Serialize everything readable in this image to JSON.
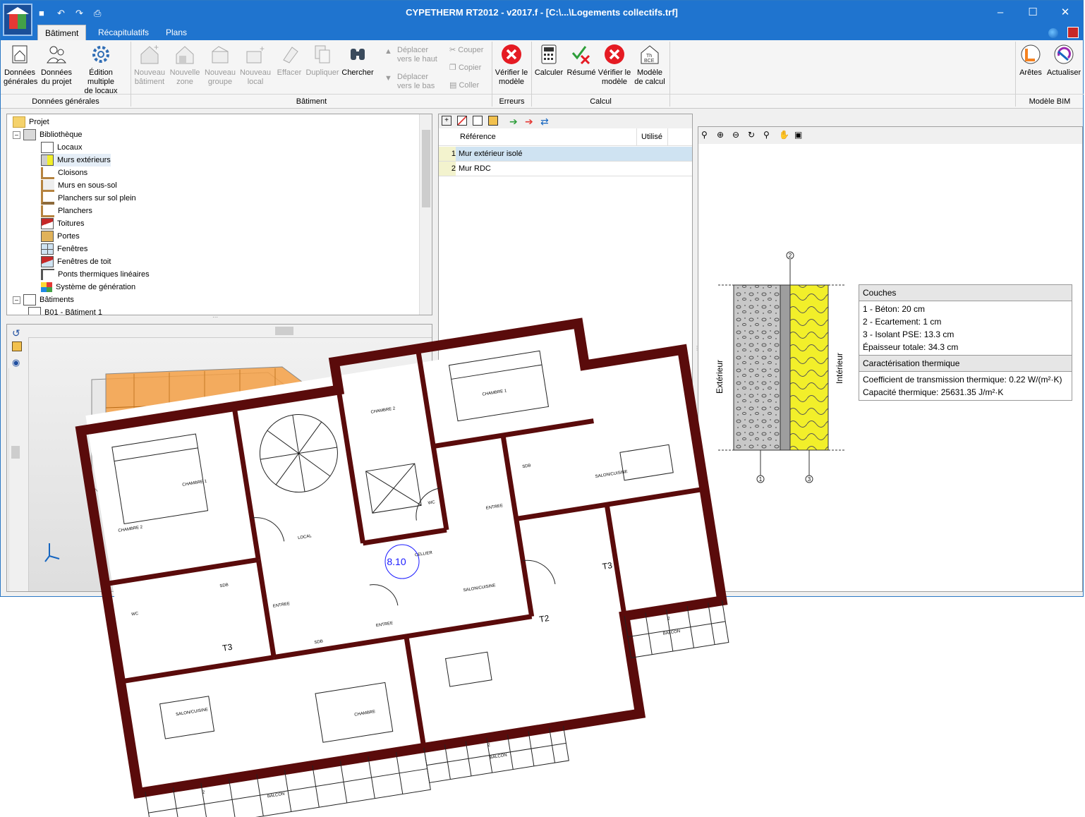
{
  "window": {
    "title": "CYPETHERM RT2012 - v2017.f - [C:\\...\\Logements collectifs.trf]"
  },
  "colors": {
    "titlebar": "#1f74cf",
    "wall": "#5a0b0b",
    "insulation": "#f2ef2a",
    "concrete": "#c8c8c8",
    "selection": "#cfe3f2"
  },
  "tabs": [
    {
      "label": "Bâtiment"
    },
    {
      "label": "Récapitulatifs"
    },
    {
      "label": "Plans"
    }
  ],
  "ribbon": {
    "buttons": [
      {
        "label": "Données générales",
        "l1": "Données",
        "l2": "générales"
      },
      {
        "label": "Données du projet",
        "l1": "Données",
        "l2": "du projet"
      },
      {
        "label": "Édition multiple de locaux",
        "l1": "Édition multiple",
        "l2": "de locaux"
      },
      {
        "label": "Nouveau bâtiment",
        "l1": "Nouveau",
        "l2": "bâtiment"
      },
      {
        "label": "Nouvelle zone",
        "l1": "Nouvelle",
        "l2": "zone"
      },
      {
        "label": "Nouveau groupe",
        "l1": "Nouveau",
        "l2": "groupe"
      },
      {
        "label": "Nouveau local",
        "l1": "Nouveau",
        "l2": "local"
      },
      {
        "label": "Effacer",
        "l1": "Effacer",
        "l2": ""
      },
      {
        "label": "Dupliquer",
        "l1": "Dupliquer",
        "l2": ""
      },
      {
        "label": "Chercher",
        "l1": "Chercher",
        "l2": ""
      },
      {
        "label": "Vérifier le modèle",
        "l1": "Vérifier le",
        "l2": "modèle"
      },
      {
        "label": "Calculer",
        "l1": "Calculer",
        "l2": ""
      },
      {
        "label": "Résumé",
        "l1": "Résumé",
        "l2": ""
      },
      {
        "label": "Vérifier le modèle",
        "l1": "Vérifier le",
        "l2": "modèle"
      },
      {
        "label": "Modèle de calcul",
        "l1": "Modèle",
        "l2": "de calcul"
      },
      {
        "label": "Arêtes",
        "l1": "Arêtes",
        "l2": ""
      },
      {
        "label": "Actualiser",
        "l1": "Actualiser",
        "l2": ""
      }
    ],
    "move_up": {
      "l1": "Déplacer",
      "l2": "vers le haut"
    },
    "move_down": {
      "l1": "Déplacer",
      "l2": "vers le bas"
    },
    "cut": "Couper",
    "copy": "Copier",
    "paste": "Coller",
    "groups": [
      "Données générales",
      "Bâtiment",
      "Erreurs",
      "Calcul",
      "Modèle BIM"
    ]
  },
  "tree": {
    "items": [
      {
        "label": "Projet"
      },
      {
        "label": "Bibliothèque"
      },
      {
        "label": "Locaux"
      },
      {
        "label": "Murs extérieurs"
      },
      {
        "label": "Cloisons"
      },
      {
        "label": "Murs en sous-sol"
      },
      {
        "label": "Planchers sur sol plein"
      },
      {
        "label": "Planchers"
      },
      {
        "label": "Toitures"
      },
      {
        "label": "Portes"
      },
      {
        "label": "Fenêtres"
      },
      {
        "label": "Fenêtres de toit"
      },
      {
        "label": "Ponts thermiques linéaires"
      },
      {
        "label": "Système de génération"
      },
      {
        "label": "Bâtiments"
      },
      {
        "label": "B01 - Bâtiment 1"
      }
    ]
  },
  "grid": {
    "headers": [
      "Référence",
      "Utilisé"
    ],
    "rows": [
      {
        "num": "1",
        "ref": "Mur extérieur isolé",
        "used": ""
      },
      {
        "num": "2",
        "ref": "Mur RDC",
        "used": ""
      }
    ]
  },
  "section": {
    "label_ext": "Extérieur",
    "label_int": "Intérieur",
    "markers": [
      "2",
      "1",
      "3"
    ],
    "couches_title": "Couches",
    "couches": [
      "1 - Béton: 20 cm",
      "2 - Ecartement: 1 cm",
      "3 - Isolant PSE: 13.3 cm",
      "Épaisseur totale: 34.3 cm"
    ],
    "thermal_title": "Caractérisation thermique",
    "thermal": [
      "Coefficient de transmission thermique: 0.22 W/(m²·K)",
      "Capacité thermique: 25631.35 J/m²·K"
    ]
  },
  "plan": {
    "rooms": [
      "CHAMBRE 1",
      "CHAMBRE 2",
      "CHAMBRE 2",
      "CHAMBRE 1",
      "SDB",
      "SDB",
      "SDB",
      "WC",
      "WC",
      "ENTREE",
      "ENTREE",
      "ENTREE",
      "LOCAL",
      "CELLIER",
      "SALON/CUISINE",
      "SALON/CUISINE",
      "SALON/CUISINE",
      "CHAMBRE",
      "BALCON",
      "BALCON",
      "BALCON"
    ],
    "units": [
      "T3",
      "T3",
      "T2"
    ],
    "marker": "8.10",
    "small": [
      "2",
      "2",
      "2"
    ]
  }
}
